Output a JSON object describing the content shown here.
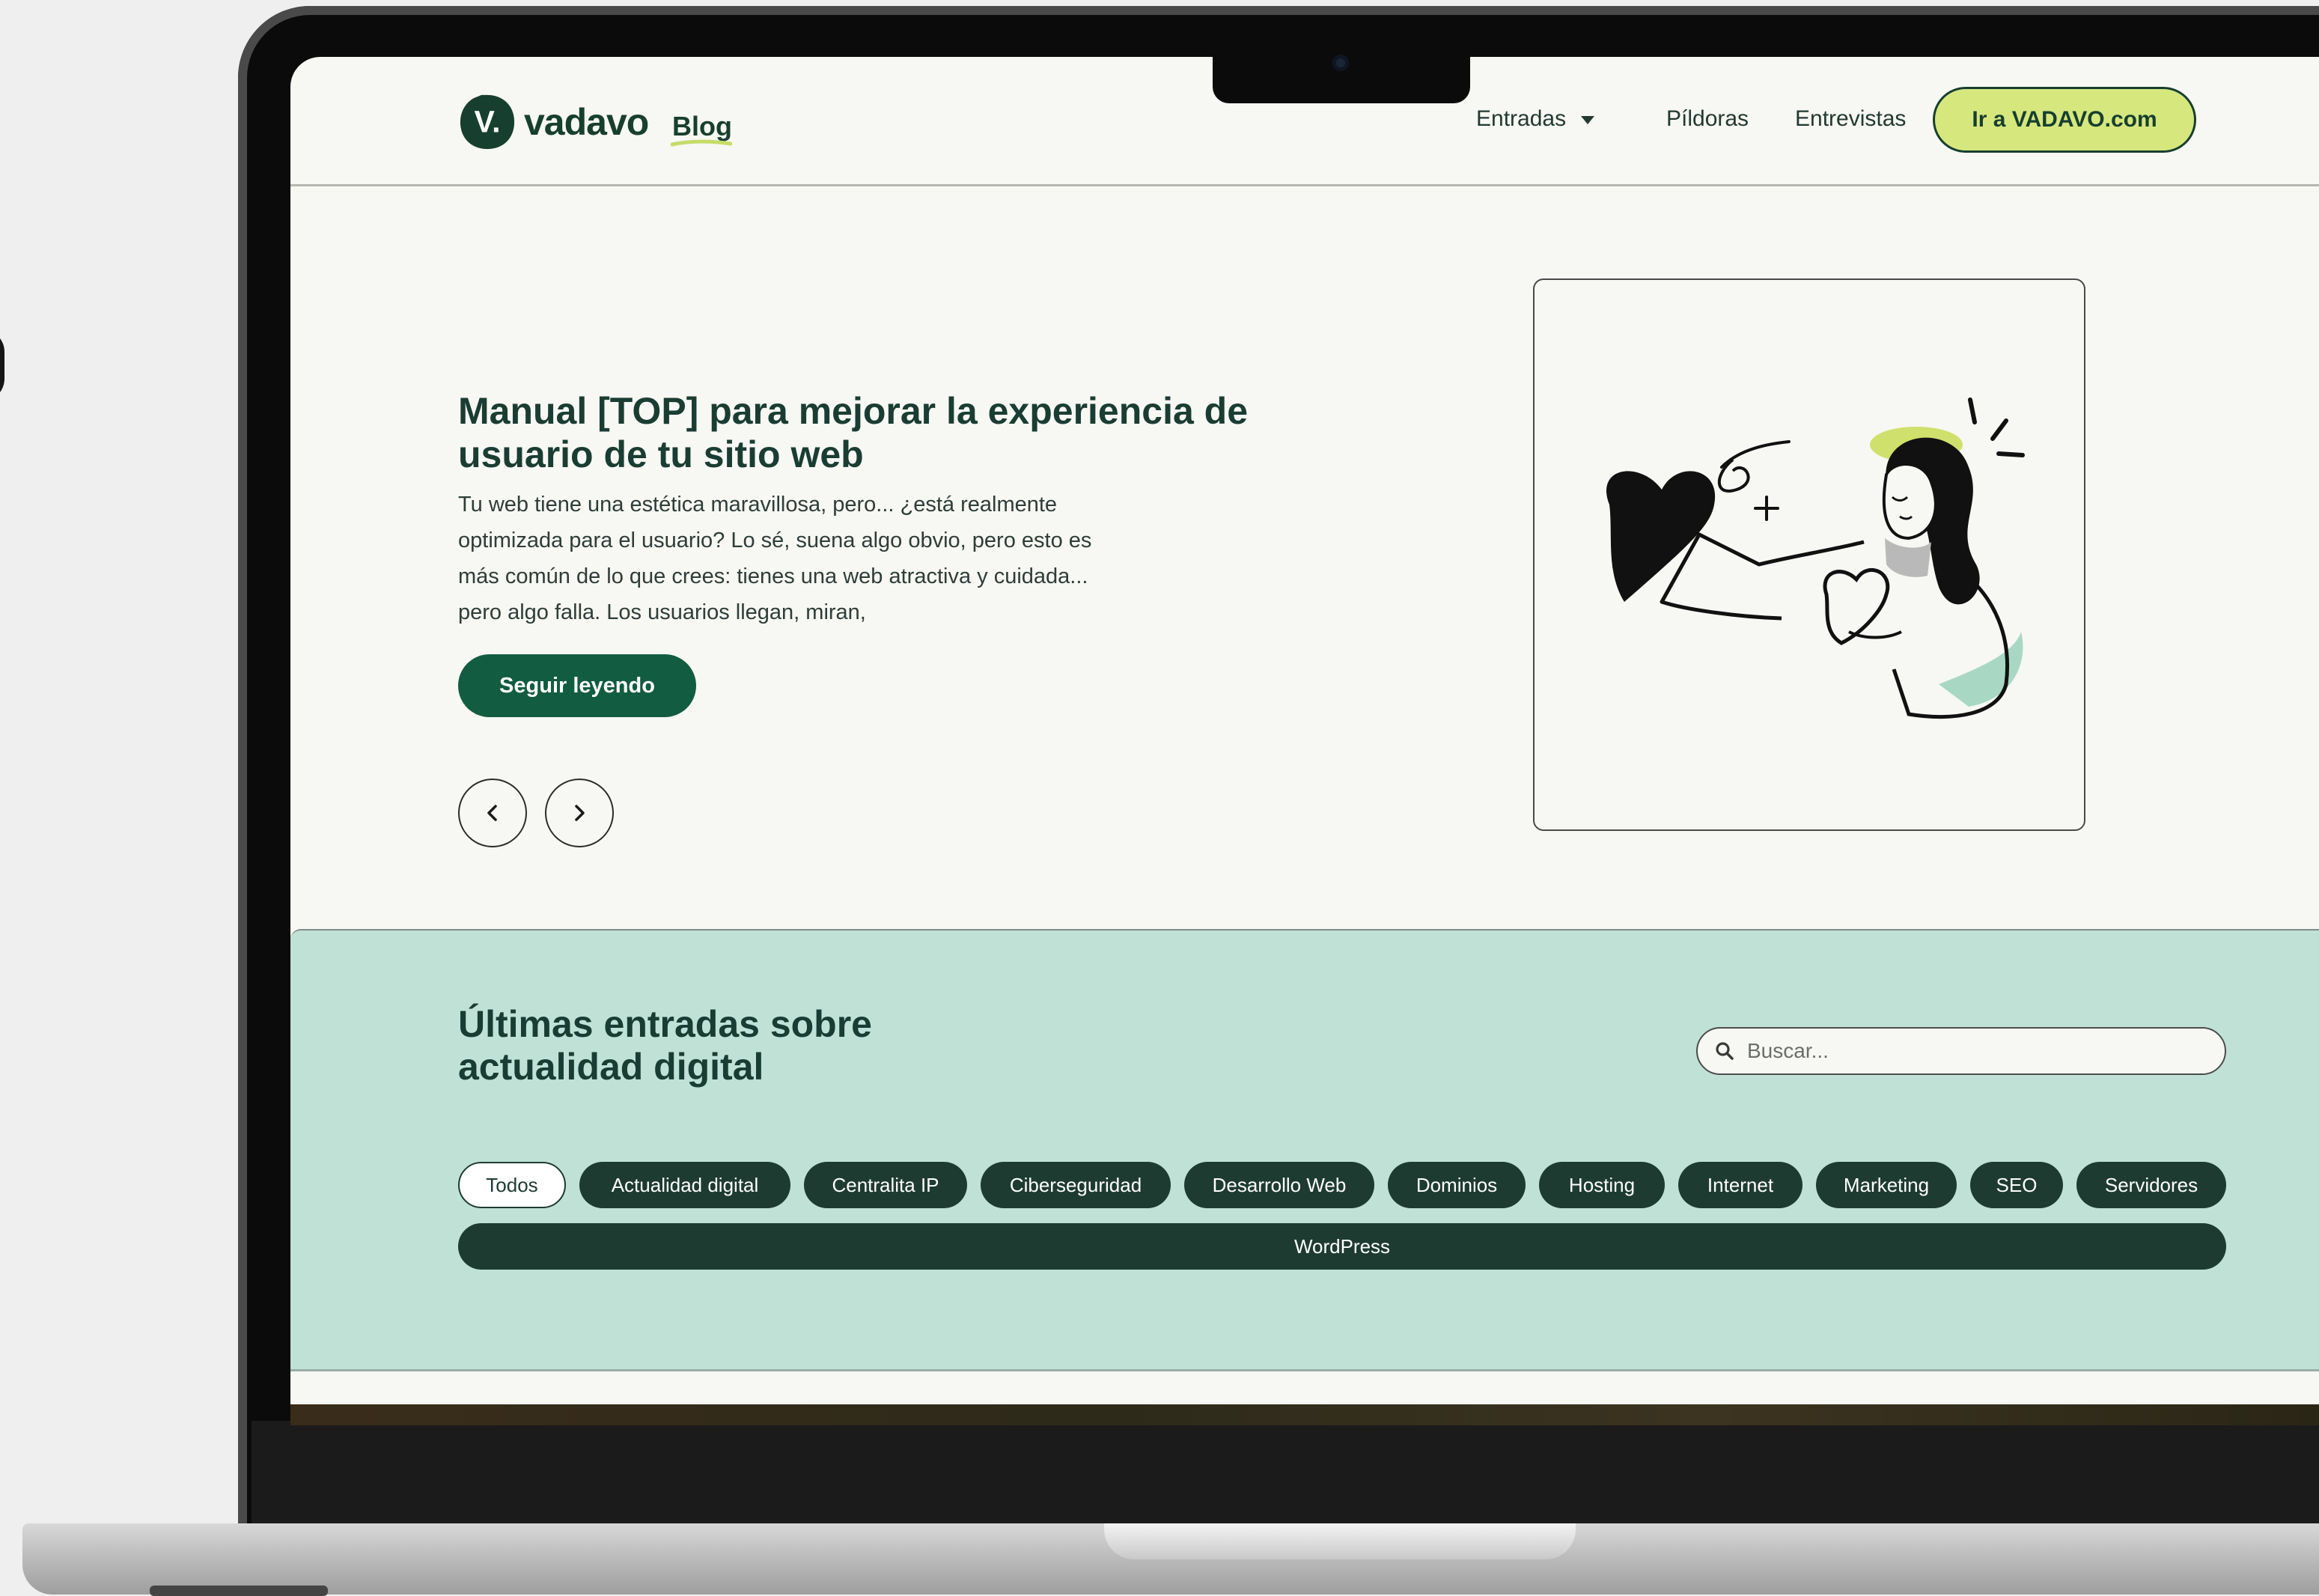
{
  "header": {
    "logo_text": "vadavo",
    "logo_sub": "Blog",
    "nav": [
      {
        "label": "Entradas"
      },
      {
        "label": "Píldoras"
      },
      {
        "label": "Entrevistas"
      }
    ],
    "cta_label": "Ir a VADAVO.com"
  },
  "hero": {
    "title": "Manual [TOP] para mejorar la experiencia de usuario de tu sitio web",
    "excerpt_lines": [
      "Tu web tiene una estética maravillosa, pero... ¿está realmente",
      "optimizada para el usuario? Lo sé, suena algo obvio, pero esto es",
      "más común de lo que crees: tienes una web atractiva y cuidada...",
      "pero algo falla. Los usuarios llegan, miran,"
    ],
    "read_more_label": "Seguir leyendo",
    "prev_icon": "chevron-left-icon",
    "next_icon": "chevron-right-icon",
    "illustration": "woman-holding-hearts-illustration"
  },
  "latest": {
    "title_lines": [
      "Últimas entradas sobre",
      "actualidad digital"
    ],
    "search_placeholder": "Buscar...",
    "categories": [
      "Todos",
      "Actualidad digital",
      "Centralita IP",
      "Ciberseguridad",
      "Desarrollo Web",
      "Dominios",
      "Hosting",
      "Internet",
      "Marketing",
      "SEO",
      "Servidores"
    ],
    "active_category": "Todos",
    "wide_category": "WordPress"
  },
  "colors": {
    "brand_dark": "#173f2f",
    "accent_lime": "#d6e77e",
    "button_green": "#125c42",
    "band_mint": "#c0e1d6",
    "pill_dark": "#1e3b32"
  }
}
